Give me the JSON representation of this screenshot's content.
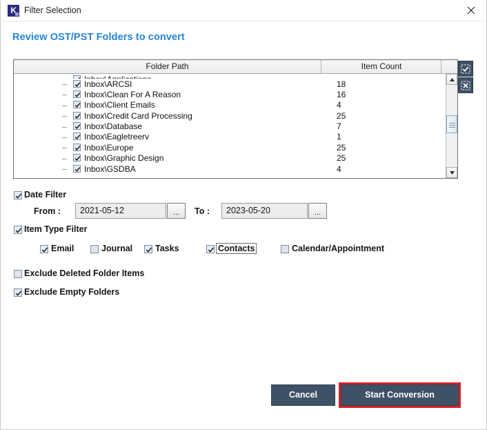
{
  "window": {
    "title": "Filter Selection",
    "app_icon": "K",
    "close_icon": "close-icon"
  },
  "heading": "Review OST/PST Folders to convert",
  "list": {
    "columns": {
      "folder_path": "Folder Path",
      "item_count": "Item Count"
    },
    "rows": [
      {
        "label": "Inbox\\Applications",
        "count": "",
        "checked": true,
        "clipped": true
      },
      {
        "label": "Inbox\\ARCSI",
        "count": "18",
        "checked": true
      },
      {
        "label": "Inbox\\Clean For A Reason",
        "count": "16",
        "checked": true
      },
      {
        "label": "Inbox\\Client Emails",
        "count": "4",
        "checked": true
      },
      {
        "label": "Inbox\\Credit Card Processing",
        "count": "25",
        "checked": true
      },
      {
        "label": "Inbox\\Database",
        "count": "7",
        "checked": true
      },
      {
        "label": "Inbox\\Eagletreerv",
        "count": "1",
        "checked": true
      },
      {
        "label": "Inbox\\Europe",
        "count": "25",
        "checked": true
      },
      {
        "label": "Inbox\\Graphic Design",
        "count": "25",
        "checked": true
      },
      {
        "label": "Inbox\\GSDBA",
        "count": "4",
        "checked": true
      }
    ],
    "side_buttons": {
      "check_all": "check-all-icon",
      "uncheck_all": "uncheck-all-icon"
    },
    "scrollbar": {
      "up_icon": "scroll-up-icon",
      "down_icon": "scroll-down-icon"
    }
  },
  "filters": {
    "date_filter": {
      "label": "Date Filter",
      "checked": true
    },
    "from_label": "From :",
    "from_value": "2021-05-12",
    "to_label": "To :",
    "to_value": "2023-05-20",
    "browse_label": "...",
    "item_type_filter": {
      "label": "Item Type Filter",
      "checked": true
    },
    "types": [
      {
        "label": "Email",
        "checked": true,
        "focused": false
      },
      {
        "label": "Journal",
        "checked": false,
        "focused": false
      },
      {
        "label": "Tasks",
        "checked": true,
        "focused": false
      },
      {
        "label": "Contacts",
        "checked": true,
        "focused": true
      },
      {
        "label": "Calendar/Appointment",
        "checked": false,
        "focused": false
      }
    ],
    "exclude_deleted": {
      "label": "Exclude Deleted Folder Items",
      "checked": false
    },
    "exclude_empty": {
      "label": "Exclude Empty Folders",
      "checked": true
    }
  },
  "footer": {
    "cancel": "Cancel",
    "start": "Start Conversion"
  },
  "colors": {
    "heading": "#2585d3",
    "button": "#3f5166",
    "highlight": "#d62027",
    "app_icon_bg": "#2b2b80"
  }
}
